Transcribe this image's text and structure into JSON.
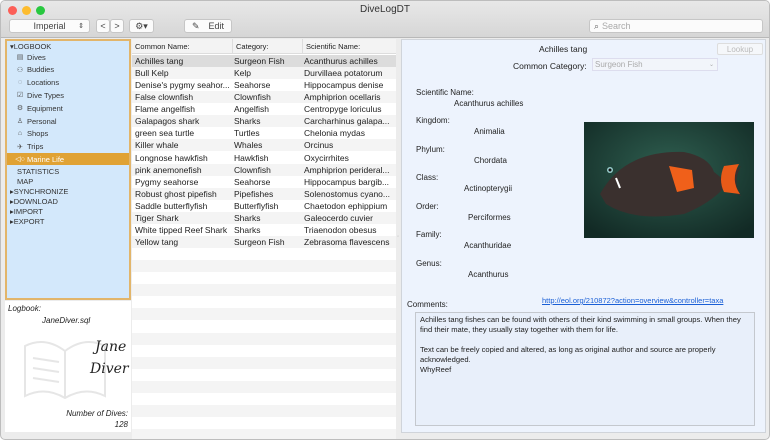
{
  "window": {
    "title": "DiveLogDT"
  },
  "toolbar": {
    "units": "Imperial",
    "back": "<",
    "forward": ">",
    "edit": "Edit",
    "search_placeholder": "Search"
  },
  "sidebar": {
    "logbook": "LOGBOOK",
    "items": [
      {
        "label": "Dives",
        "icon": "dives-icon",
        "glyph": "▤"
      },
      {
        "label": "Buddies",
        "icon": "buddies-icon",
        "glyph": "⚇"
      },
      {
        "label": "Locations",
        "icon": "location-icon",
        "glyph": "◌"
      },
      {
        "label": "Dive Types",
        "icon": "checkbox-icon",
        "glyph": "☑"
      },
      {
        "label": "Equipment",
        "icon": "equipment-icon",
        "glyph": "⚙"
      },
      {
        "label": "Personal",
        "icon": "person-icon",
        "glyph": "♙"
      },
      {
        "label": "Shops",
        "icon": "shop-icon",
        "glyph": "⌂"
      },
      {
        "label": "Trips",
        "icon": "plane-icon",
        "glyph": "✈"
      },
      {
        "label": "Marine Life",
        "icon": "fish-icon",
        "glyph": "◁○"
      }
    ],
    "sections": [
      "STATISTICS",
      "MAP"
    ],
    "groups": [
      "SYNCHRONIZE",
      "DOWNLOAD",
      "IMPORT",
      "EXPORT"
    ],
    "selected_color": "#e0a234"
  },
  "logbook_info": {
    "label": "Logbook:",
    "file": "JaneDiver.sql",
    "signature_line1": "Jane",
    "signature_line2": "Diver",
    "dives_label": "Number of Dives:",
    "dives": "128"
  },
  "table": {
    "columns": [
      "Common Name:",
      "Category:",
      "Scientific Name:"
    ],
    "rows": [
      [
        "Achilles tang",
        "Surgeon Fish",
        "Acanthurus achilles"
      ],
      [
        "Bull Kelp",
        "Kelp",
        "Durvillaea potatorum"
      ],
      [
        "Denise's pygmy seahor...",
        "Seahorse",
        "Hippocampus denise"
      ],
      [
        "False clownfish",
        "Clownfish",
        "Amphiprion ocellaris"
      ],
      [
        "Flame angelfish",
        "Angelfish",
        "Centropyge loriculus"
      ],
      [
        "Galapagos shark",
        "Sharks",
        "Carcharhinus galapa..."
      ],
      [
        "green sea turtle",
        "Turtles",
        "Chelonia mydas"
      ],
      [
        "Killer whale",
        "Whales",
        "Orcinus"
      ],
      [
        "Longnose hawkfish",
        "Hawkfish",
        "Oxycirrhites"
      ],
      [
        "pink anemonefish",
        "Clownfish",
        "Amphiprion perideral..."
      ],
      [
        "Pygmy seahorse",
        "Seahorse",
        "Hippocampus bargib..."
      ],
      [
        "Robust ghost pipefish",
        "Pipefishes",
        "Solenostomus cyano..."
      ],
      [
        "Saddle butterflyfish",
        "Butterflyfish",
        "Chaetodon ephippium"
      ],
      [
        "Tiger Shark",
        "Sharks",
        "Galeocerdo cuvier"
      ],
      [
        "White tipped Reef Shark",
        "Sharks",
        "Triaenodon obesus"
      ],
      [
        "Yellow tang",
        "Surgeon Fish",
        "Zebrasoma flavescens"
      ]
    ]
  },
  "detail": {
    "name": "Achilles tang",
    "lookup": "Lookup",
    "category_label": "Common Category:",
    "category": "Surgeon Fish",
    "fields": [
      {
        "label": "Scientific Name:",
        "value": "Acanthurus achilles"
      },
      {
        "label": "Kingdom:",
        "value": "Animalia"
      },
      {
        "label": "Phylum:",
        "value": "Chordata"
      },
      {
        "label": "Class:",
        "value": "Actinopterygii"
      },
      {
        "label": "Order:",
        "value": "Perciformes"
      },
      {
        "label": "Family:",
        "value": "Acanthuridae"
      },
      {
        "label": "Genus:",
        "value": "Acanthurus"
      }
    ],
    "comments_label": "Comments:",
    "link": "http://eol.org/210872?action=overview&controller=taxa",
    "comments": "Achilles tang fishes can be found with others of their kind swimming in small groups. When they find their mate, they usually stay together with them for life.\n\nText can be freely copied and altered, as long as original author and source are properly acknowledged.\nWhyReef"
  }
}
